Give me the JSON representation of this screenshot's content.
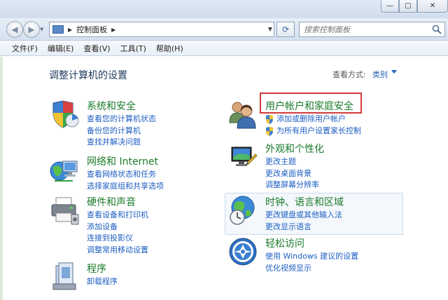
{
  "window": {
    "min_glyph": "—",
    "max_glyph": "▢",
    "close_glyph": "✕"
  },
  "address": {
    "path": "控制面板",
    "search_placeholder": "搜索控制面板"
  },
  "menu": [
    "文件(F)",
    "编辑(E)",
    "查看(V)",
    "工具(T)",
    "帮助(H)"
  ],
  "header": {
    "title": "调整计算机的设置",
    "view_label": "查看方式:",
    "view_value": "类别"
  },
  "categories": {
    "system": {
      "icon": "shield-icon",
      "title": "系统和安全",
      "links": [
        "查看您的计算机状态",
        "备份您的计算机",
        "查找并解决问题"
      ]
    },
    "network": {
      "icon": "network-globe-icon",
      "title": "网络和 Internet",
      "links": [
        "查看网络状态和任务",
        "选择家庭组和共享选项"
      ]
    },
    "hardware": {
      "icon": "printer-icon",
      "title": "硬件和声音",
      "links": [
        "查看设备和打印机",
        "添加设备",
        "连接到投影仪",
        "调整常用移动设置"
      ]
    },
    "programs": {
      "icon": "programs-icon",
      "title": "程序",
      "links": [
        "卸载程序"
      ]
    },
    "users": {
      "icon": "users-icon",
      "title": "用户帐户和家庭安全",
      "links": [
        "添加或删除用户帐户",
        "为所有用户设置家长控制"
      ]
    },
    "appearance": {
      "icon": "monitor-icon",
      "title": "外观和个性化",
      "links": [
        "更改主题",
        "更改桌面背景",
        "调整屏幕分辨率"
      ]
    },
    "clock": {
      "icon": "globe-clock-icon",
      "title": "时钟、语言和区域",
      "links": [
        "更改键盘或其他输入法",
        "更改显示语言"
      ]
    },
    "access": {
      "icon": "ease-of-access-icon",
      "title": "轻松访问",
      "links": [
        "使用 Windows 建议的设置",
        "优化视频显示"
      ]
    }
  },
  "colors": {
    "category_title": "#1a7a2a",
    "link": "#1d5ec2",
    "highlight": "#d33a3a"
  }
}
